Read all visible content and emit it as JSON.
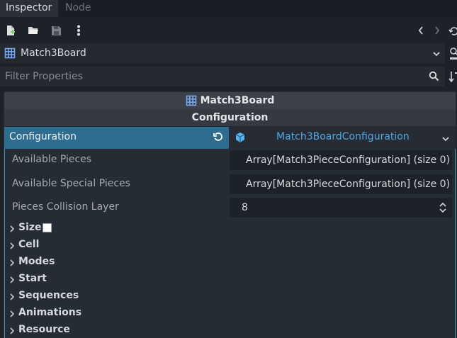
{
  "tabs": [
    {
      "label": "Inspector",
      "active": true
    },
    {
      "label": "Node",
      "active": false
    }
  ],
  "toolbar": {
    "buttons": [
      "new-resource-icon",
      "open-folder-icon",
      "save-icon",
      "more-vert-icon"
    ],
    "nav": [
      "chevron-left-icon",
      "chevron-right-icon"
    ]
  },
  "object_selector": {
    "label": "Match3Board",
    "icon": "grid-node-icon"
  },
  "filter": {
    "placeholder": "Filter Properties"
  },
  "section": {
    "title": "Match3Board",
    "category": "Configuration"
  },
  "configuration": {
    "label": "Configuration",
    "value": "Match3BoardConfiguration",
    "accent": "#2f6d90",
    "value_color": "#4ea8e6"
  },
  "properties": [
    {
      "name": "Available Pieces",
      "value": "Array[Match3PieceConfiguration] (size 0)"
    },
    {
      "name": "Available Special Pieces",
      "value": "Array[Match3PieceConfiguration] (size 0)"
    },
    {
      "name": "Pieces Collision Layer",
      "value": "8"
    }
  ],
  "groups": [
    {
      "label": "Size",
      "checkbox": true
    },
    {
      "label": "Cell"
    },
    {
      "label": "Modes"
    },
    {
      "label": "Start"
    },
    {
      "label": "Sequences"
    },
    {
      "label": "Animations"
    },
    {
      "label": "Resource"
    }
  ]
}
